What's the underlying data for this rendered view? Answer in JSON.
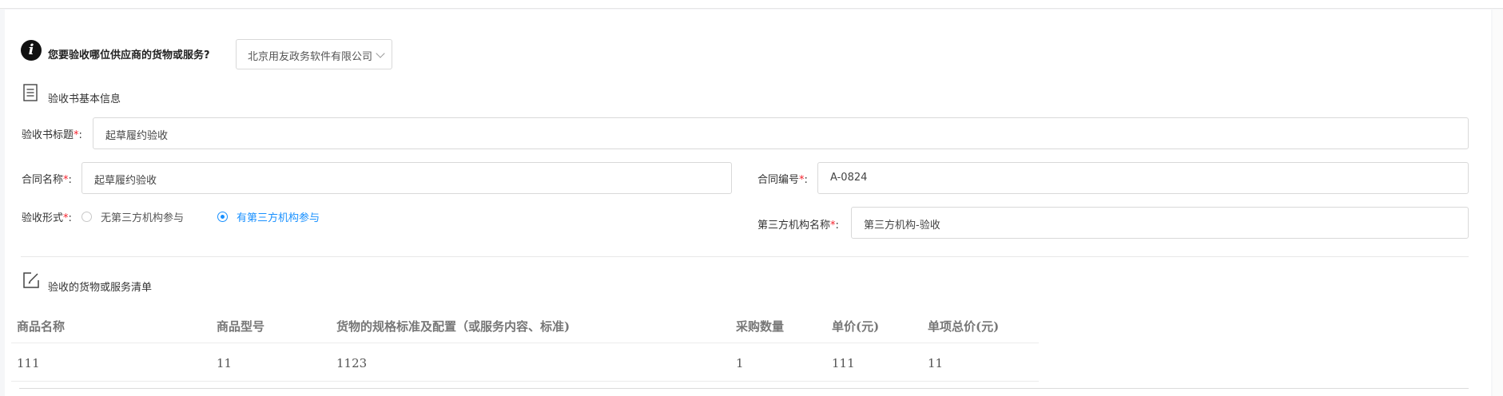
{
  "question": {
    "icon": "info-icon",
    "text": "您要验收哪位供应商的货物或服务?",
    "supplier_value": "北京用友政务软件有限公司"
  },
  "basic_section": {
    "icon": "document-list-icon",
    "title": "验收书基本信息"
  },
  "form": {
    "required_mark": "*",
    "colon": ":",
    "acceptance_title": {
      "label": "验收书标题",
      "value": "起草履约验收"
    },
    "contract_name": {
      "label": "合同名称",
      "value": "起草履约验收"
    },
    "contract_no": {
      "label": "合同编号",
      "value": "A-0824"
    },
    "acceptance_form": {
      "label": "验收形式",
      "options": [
        {
          "label": "无第三方机构参与",
          "selected": false
        },
        {
          "label": "有第三方机构参与",
          "selected": true
        }
      ]
    },
    "third_party_name": {
      "label": "第三方机构名称",
      "value": "第三方机构-验收"
    }
  },
  "goods_section": {
    "icon": "edit-icon",
    "title": "验收的货物或服务清单"
  },
  "table": {
    "headers": [
      "商品名称",
      "商品型号",
      "货物的规格标准及配置（或服务内容、标准)",
      "采购数量",
      "单价(元)",
      "单项总价(元)"
    ],
    "rows": [
      [
        "111",
        "11",
        "1123",
        "1",
        "111",
        "11"
      ]
    ]
  },
  "colors": {
    "accent": "#1890ff",
    "required": "#f5222d"
  }
}
